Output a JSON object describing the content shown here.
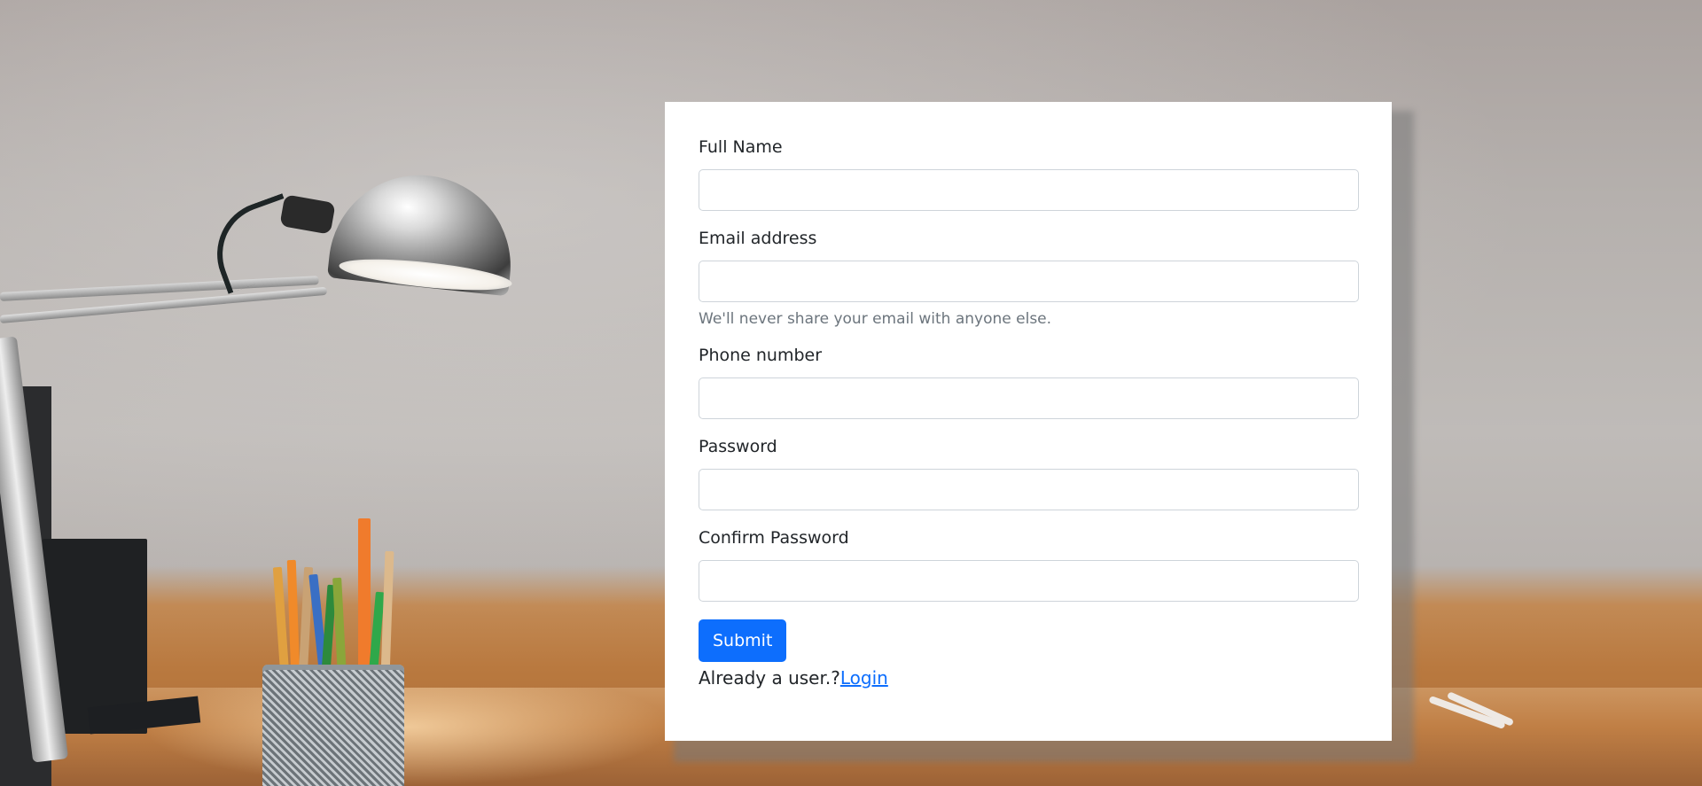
{
  "form": {
    "fields": [
      {
        "label": "Full Name",
        "value": "",
        "placeholder": ""
      },
      {
        "label": "Email address",
        "value": "",
        "placeholder": "",
        "help": "We'll never share your email with anyone else."
      },
      {
        "label": "Phone number",
        "value": "",
        "placeholder": ""
      },
      {
        "label": "Password",
        "value": "",
        "placeholder": ""
      },
      {
        "label": "Confirm Password",
        "value": "",
        "placeholder": ""
      }
    ],
    "submit_label": "Submit",
    "login_prompt": "Already a user.?",
    "login_link": "Login"
  },
  "colors": {
    "primary": "#0d6efd",
    "text": "#212529",
    "muted": "#6c757d",
    "input_border": "#ced4da"
  }
}
